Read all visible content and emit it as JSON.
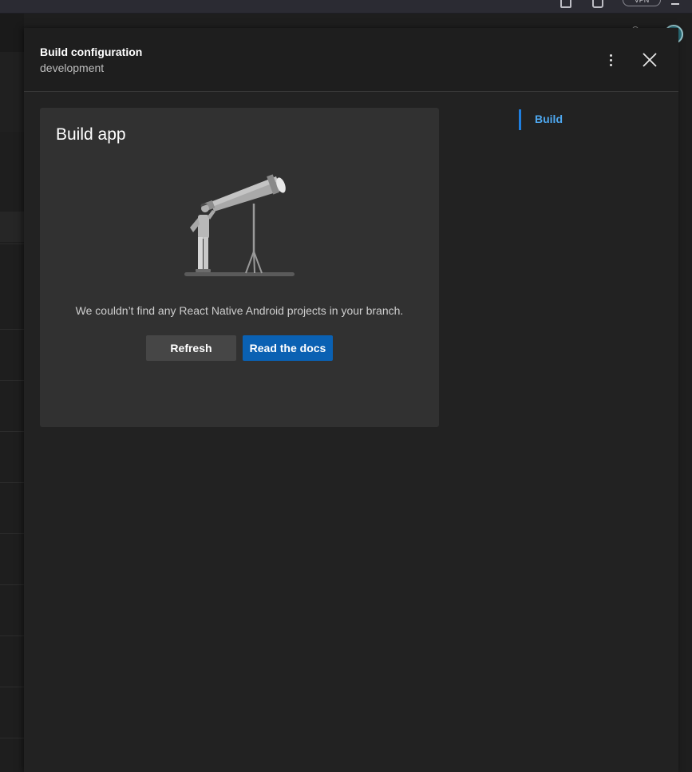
{
  "browser": {
    "extension_pill": "VPN"
  },
  "panel": {
    "title": "Build configuration",
    "subtitle": "development",
    "more_icon": "more-vertical-icon",
    "close_icon": "close-icon"
  },
  "card": {
    "title": "Build app",
    "illustration": "telescope-person-illustration",
    "message": "We couldn’t find any React Native Android projects in your branch.",
    "refresh_label": "Refresh",
    "docs_label": "Read the docs"
  },
  "side_nav": {
    "items": [
      {
        "label": "Build",
        "active": true
      }
    ]
  },
  "colors": {
    "panel_bg": "#222222",
    "card_bg": "#313131",
    "primary_button": "#0a61b3",
    "secondary_button": "#464646",
    "nav_active_text": "#4ea8f0",
    "nav_indicator": "#1f7fe0"
  }
}
